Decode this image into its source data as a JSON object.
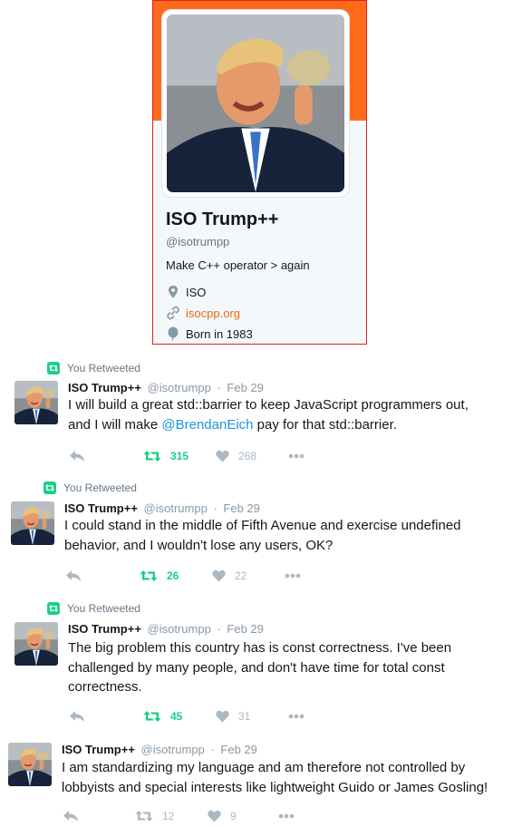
{
  "profile": {
    "name": "ISO Trump++",
    "handle": "@isotrumpp",
    "bio": "Make C++ operator > again",
    "location": "ISO",
    "website": "isocpp.org",
    "born": "Born in 1983"
  },
  "retweet_label": "You Retweeted",
  "tweets": [
    {
      "name": "ISO Trump++",
      "handle": "@isotrumpp",
      "date": "Feb 29",
      "text_line1": "I will build a great std::barrier to keep JavaScript programmers out,",
      "text_pre": "and I will make ",
      "mention": "@BrendanEich",
      "text_post": " pay for that std::barrier.",
      "retweets": "315",
      "likes": "268"
    },
    {
      "name": "ISO Trump++",
      "handle": "@isotrumpp",
      "date": "Feb 29",
      "text": "I could stand in the middle of Fifth Avenue and exercise undefined behavior, and I wouldn't lose any users, OK?",
      "retweets": "26",
      "likes": "22"
    },
    {
      "name": "ISO Trump++",
      "handle": "@isotrumpp",
      "date": "Feb 29",
      "text": "The big problem this country has is const correctness. I've been challenged by many people, and don't have time for total const correctness.",
      "retweets": "45",
      "likes": "31"
    },
    {
      "name": "ISO Trump++",
      "handle": "@isotrumpp",
      "date": "Feb 29",
      "text": "I am standardizing my language and am therefore not controlled by lobbyists and special interests like lightweight Guido or James Gosling!",
      "retweets": "12",
      "likes": "9"
    }
  ],
  "icons": {
    "location": "map-pin-icon",
    "website": "link-icon",
    "born": "balloon-icon",
    "reply": "reply-icon",
    "retweet": "retweet-icon",
    "like": "heart-icon",
    "more": "more-dots-icon"
  },
  "colors": {
    "banner": "#ff6b1a",
    "retweet_green": "#19cf86",
    "link_blue": "#1b95e0",
    "website_orange": "#e8691a",
    "meta_grey": "#8899a6"
  }
}
